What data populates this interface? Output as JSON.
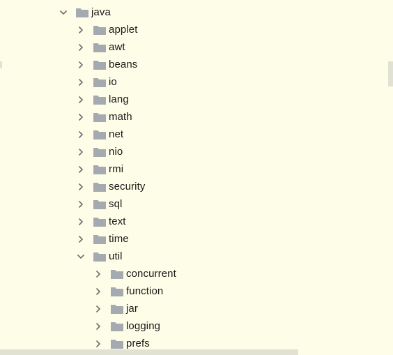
{
  "tree": {
    "items": [
      {
        "label": "java",
        "depth": 0,
        "expanded": true
      },
      {
        "label": "applet",
        "depth": 1,
        "expanded": false
      },
      {
        "label": "awt",
        "depth": 1,
        "expanded": false
      },
      {
        "label": "beans",
        "depth": 1,
        "expanded": false
      },
      {
        "label": "io",
        "depth": 1,
        "expanded": false
      },
      {
        "label": "lang",
        "depth": 1,
        "expanded": false
      },
      {
        "label": "math",
        "depth": 1,
        "expanded": false
      },
      {
        "label": "net",
        "depth": 1,
        "expanded": false
      },
      {
        "label": "nio",
        "depth": 1,
        "expanded": false
      },
      {
        "label": "rmi",
        "depth": 1,
        "expanded": false
      },
      {
        "label": "security",
        "depth": 1,
        "expanded": false
      },
      {
        "label": "sql",
        "depth": 1,
        "expanded": false
      },
      {
        "label": "text",
        "depth": 1,
        "expanded": false
      },
      {
        "label": "time",
        "depth": 1,
        "expanded": false
      },
      {
        "label": "util",
        "depth": 1,
        "expanded": true
      },
      {
        "label": "concurrent",
        "depth": 2,
        "expanded": false
      },
      {
        "label": "function",
        "depth": 2,
        "expanded": false
      },
      {
        "label": "jar",
        "depth": 2,
        "expanded": false
      },
      {
        "label": "logging",
        "depth": 2,
        "expanded": false
      },
      {
        "label": "prefs",
        "depth": 2,
        "expanded": false
      }
    ]
  },
  "icons": {
    "chevron_collapsed": "chevron-right-icon",
    "chevron_expanded": "chevron-down-icon",
    "folder": "folder-icon"
  },
  "colors": {
    "background": "#fdfde8",
    "folder": "#a4aab0",
    "chevron": "#6e6e6e",
    "scrollbar": "#e2e2d2"
  }
}
